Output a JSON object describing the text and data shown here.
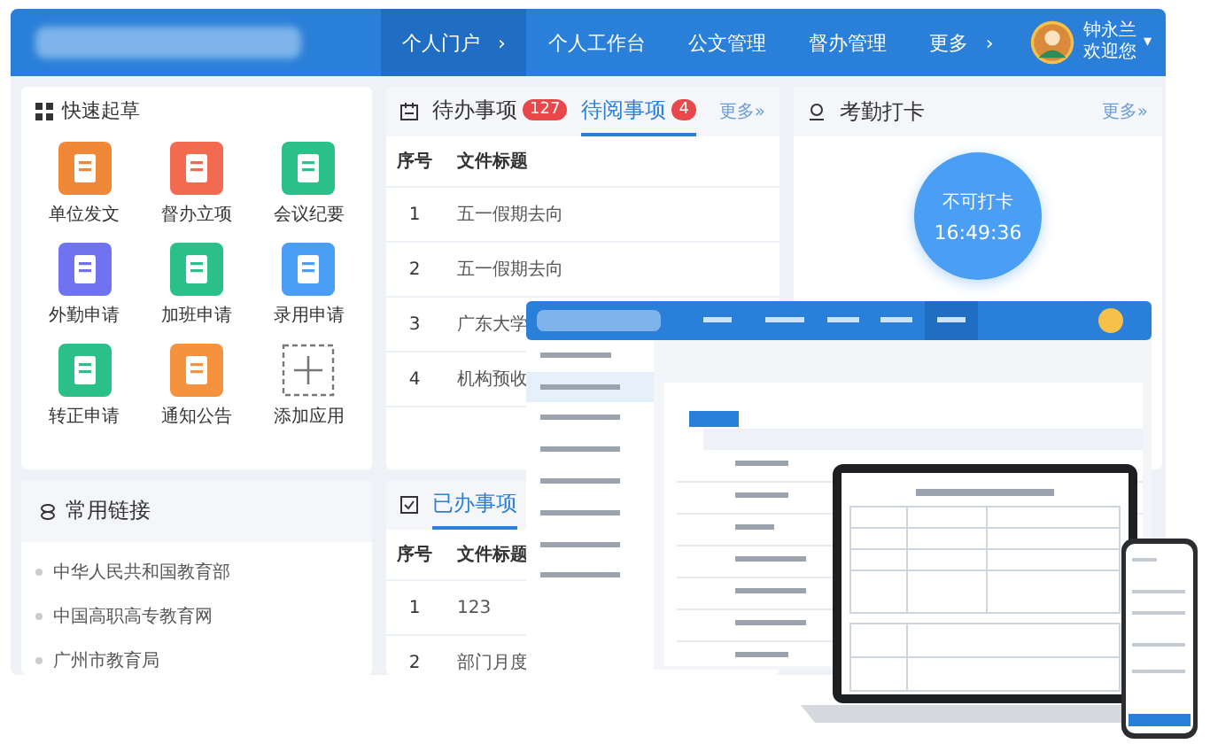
{
  "header": {
    "nav": [
      {
        "label": "个人门户",
        "arrow": "›",
        "selected": true
      },
      {
        "label": "个人工作台",
        "selected": false
      },
      {
        "label": "公文管理",
        "selected": false
      },
      {
        "label": "督办管理",
        "selected": false
      },
      {
        "label": "更多",
        "arrow": "›",
        "selected": false
      }
    ],
    "user": {
      "name": "钟永兰",
      "greeting": "欢迎您",
      "caret": "▾"
    }
  },
  "quick_draft": {
    "title": "快速起草",
    "apps": [
      {
        "kind": "app",
        "label": "单位发文",
        "color": "#f0883a"
      },
      {
        "kind": "app",
        "label": "督办立项",
        "color": "#f26a4f"
      },
      {
        "kind": "app",
        "label": "会议纪要",
        "color": "#2bbf8a"
      },
      {
        "kind": "app",
        "label": "外勤申请",
        "color": "#6f73f0"
      },
      {
        "kind": "app",
        "label": "加班申请",
        "color": "#2bbf8a"
      },
      {
        "kind": "app",
        "label": "录用申请",
        "color": "#4a9ff5"
      },
      {
        "kind": "app",
        "label": "转正申请",
        "color": "#2bbf8a"
      },
      {
        "kind": "app",
        "label": "通知公告",
        "color": "#f5923e"
      },
      {
        "kind": "add",
        "label": "添加应用"
      }
    ]
  },
  "links": {
    "title": "常用链接",
    "items": [
      "中华人民共和国教育部",
      "中国高职高专教育网",
      "广州市教育局"
    ]
  },
  "todo": {
    "tabs": [
      {
        "label": "待办事项",
        "count": "127",
        "selected": false
      },
      {
        "label": "待阅事项",
        "count": "4",
        "selected": true
      }
    ],
    "more": "更多»",
    "columns": [
      "序号",
      "文件标题"
    ],
    "rows": [
      [
        "1",
        "五一假期去向"
      ],
      [
        "2",
        "五一假期去向"
      ],
      [
        "3",
        "广东大学"
      ],
      [
        "4",
        "机构预收"
      ]
    ]
  },
  "done": {
    "tabs": [
      {
        "label": "已办事项",
        "selected": true
      }
    ],
    "columns": [
      "序号",
      "文件标题"
    ],
    "rows": [
      [
        "1",
        "123"
      ],
      [
        "2",
        "部门月度"
      ]
    ]
  },
  "attendance": {
    "title": "考勤打卡",
    "more": "更多»",
    "status": "不可打卡",
    "time": "16:49:36"
  }
}
